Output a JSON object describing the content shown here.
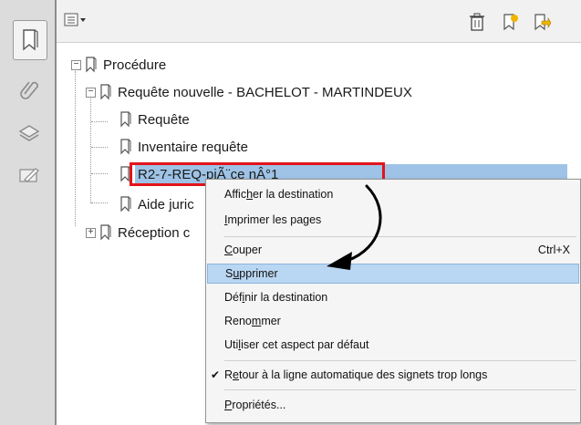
{
  "toolbar": {
    "options_icon": "options-list-icon",
    "delete_icon": "trash-icon",
    "new_bookmark_icon": "new-bookmark-icon",
    "expand_bookmark_icon": "bookmark-arrow-icon"
  },
  "tree": {
    "root": "Procédure",
    "child1": "Requête nouvelle - BACHELOT -  MARTINDEUX",
    "child1_items": [
      "Requête",
      "Inventaire requête",
      "R2-7-REQ-piÃ¨ce nÂ°1",
      "Aide juric"
    ],
    "child2": "Réception c"
  },
  "menu": {
    "items": [
      {
        "pre": "Affic",
        "u": "h",
        "post": "er la destination"
      },
      {
        "pre": "",
        "u": "I",
        "post": "mprimer les pages"
      },
      {
        "pre": "",
        "u": "C",
        "post": "ouper",
        "shortcut": "Ctrl+X"
      },
      {
        "pre": "S",
        "u": "u",
        "post": "pprimer"
      },
      {
        "pre": "Déf",
        "u": "i",
        "post": "nir la destination"
      },
      {
        "pre": "Reno",
        "u": "m",
        "post": "mer"
      },
      {
        "pre": "Uti",
        "u": "l",
        "post": "iser cet aspect par défaut"
      },
      {
        "pre": "R",
        "u": "e",
        "post": "tour à la ligne automatique des signets trop longs"
      },
      {
        "pre": "",
        "u": "P",
        "post": "ropriétés..."
      }
    ]
  },
  "colors": {
    "selection": "#9ec3e6",
    "highlight_box": "#e3141b",
    "menu_highlight": "#b9d6f2"
  }
}
